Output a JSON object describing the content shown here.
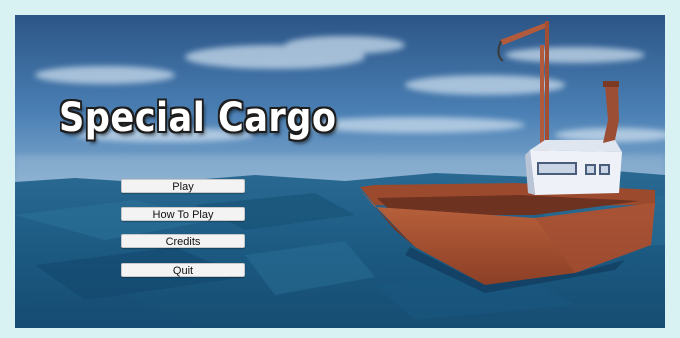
{
  "game": {
    "title": "Special Cargo"
  },
  "menu": {
    "play_label": "Play",
    "how_to_play_label": "How To Play",
    "credits_label": "Credits",
    "quit_label": "Quit"
  },
  "colors": {
    "frame": "#d8f2f3",
    "sky": "#3f6fa6",
    "sea": "#1f5f86",
    "boat_hull": "#b0583a",
    "cabin": "#eef2f8",
    "title_text": "#ffffff",
    "button_bg": "#f3f3f3"
  }
}
